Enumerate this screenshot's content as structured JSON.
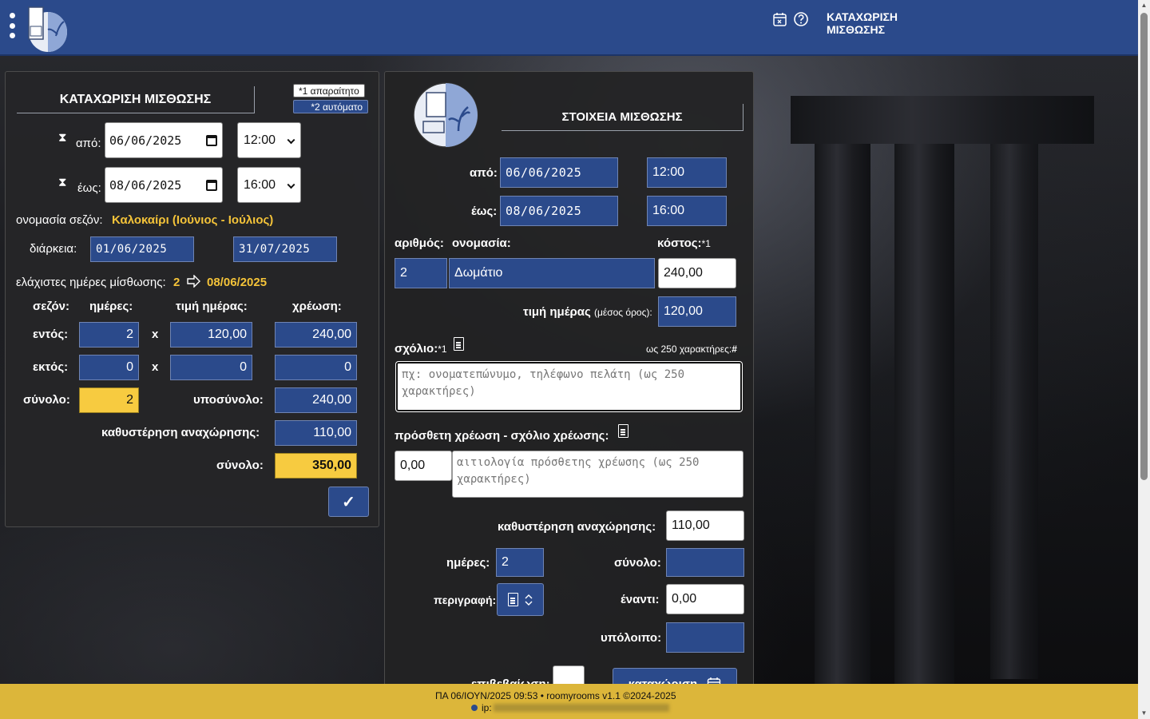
{
  "header": {
    "title_line1": "ΚΑΤΑΧΩΡΙΣΗ",
    "title_line2": "ΜΙΣΘΩΣΗΣ"
  },
  "left": {
    "title": "ΚΑΤΑΧΩΡΙΣΗ ΜΙΣΘΩΣΗΣ",
    "tag_required": "*1 απαραίτητο",
    "tag_auto": "*2 αυτόματο",
    "from_label": "από:",
    "from_date": "06/06/2025",
    "from_time": "12:00",
    "to_label": "έως:",
    "to_date": "08/06/2025",
    "to_time": "16:00",
    "season_label": "ονομασία σεζόν:",
    "season_name": "Καλοκαίρι (Ιούνιος - Ιούλιος)",
    "duration_label": "διάρκεια:",
    "duration_from": "01/06/2025",
    "duration_to": "31/07/2025",
    "min_days_label": "ελάχιστες ημέρες μίσθωσης:",
    "min_days": "2",
    "min_days_date": "08/06/2025",
    "col_season": "σεζόν:",
    "col_days": "ημέρες:",
    "col_day_price": "τιμή ημέρας:",
    "col_charge": "χρέωση:",
    "row_in_label": "εντός:",
    "row_in_days": "2",
    "row_in_x": "x",
    "row_in_price": "120,00",
    "row_in_charge": "240,00",
    "row_out_label": "εκτός:",
    "row_out_days": "0",
    "row_out_x": "x",
    "row_out_price": "0",
    "row_out_charge": "0",
    "total_label": "σύνολο:",
    "total_days": "2",
    "subtotal_label": "υποσύνολο:",
    "subtotal": "240,00",
    "late_label": "καθυστέρηση αναχώρησης:",
    "late": "110,00",
    "grand_label": "σύνολο:",
    "grand_total": "350,00",
    "ok_symbol": "✓"
  },
  "right": {
    "title": "ΣΤΟΙΧΕΙΑ ΜΙΣΘΩΣΗΣ",
    "from_label": "από:",
    "from_date": "06/06/2025",
    "from_time": "12:00",
    "to_label": "έως:",
    "to_date": "08/06/2025",
    "to_time": "16:00",
    "number_label": "αριθμός:",
    "name_label": "ονομασία:",
    "cost_label": "κόστος:",
    "cost_mark": "*1",
    "number": "2",
    "name": "Δωμάτιο",
    "cost": "240,00",
    "day_price_label": "τιμή ημέρας",
    "day_price_sub": "(μέσος όρος):",
    "day_price": "120,00",
    "comment_label": "σχόλιο:",
    "comment_mark": "*1",
    "comment_limit": "ως 250 χαρακτήρες:",
    "comment_hash": "#",
    "comment_placeholder": "πχ: ονοματεπώνυμο, τηλέφωνο πελάτη (ως 250 χαρακτήρες)",
    "extra_label": "πρόσθετη χρέωση - σχόλιο χρέωσης:",
    "extra_value": "0,00",
    "extra_placeholder": "αιτιολογία πρόσθετης χρέωσης (ως 250 χαρακτήρες)",
    "late_label": "καθυστέρηση αναχώρησης:",
    "late": "110,00",
    "days_label": "ημέρες:",
    "days": "2",
    "total_label": "σύνολο:",
    "total": "",
    "desc_label": "περιγραφή:",
    "advance_label": "έναντι:",
    "advance": "0,00",
    "balance_label": "υπόλοιπο:",
    "balance": "",
    "confirm_label": "επιβεβαίωση:",
    "submit_label": "καταχώριση"
  },
  "footer": {
    "line1": "ΠΑ 06/ΙΟΥΝ/2025 09:53  • roomyrooms v1.1 ©2024-2025",
    "line2": "ip:"
  },
  "colors": {
    "header_blue": "#2b4a8b",
    "field_blue": "#2b4a8b",
    "accent_yellow": "#f4c339",
    "footer_yellow": "#dcb63a"
  },
  "icons": [
    "menu-icon",
    "logo-icon",
    "calendar-x-icon",
    "help-icon",
    "hourglass-icon",
    "calendar-icon",
    "chevron-down-icon",
    "arrow-right-icon",
    "check-icon",
    "document-icon",
    "calendar-submit-icon"
  ]
}
